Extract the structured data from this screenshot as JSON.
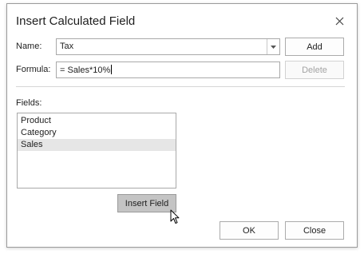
{
  "dialog": {
    "title": "Insert Calculated Field",
    "name_label": "Name:",
    "name_value": "Tax",
    "formula_label": "Formula:",
    "formula_value": "= Sales*10%",
    "fields_label": "Fields:",
    "fields": [
      {
        "label": "Product",
        "selected": false
      },
      {
        "label": "Category",
        "selected": false
      },
      {
        "label": "Sales",
        "selected": true
      }
    ],
    "buttons": {
      "add": "Add",
      "delete": "Delete",
      "insert_field": "Insert Field",
      "ok": "OK",
      "close": "Close"
    },
    "icons": {
      "close": "close-icon",
      "dropdown": "chevron-down-icon",
      "cursor": "mouse-pointer-icon"
    }
  }
}
